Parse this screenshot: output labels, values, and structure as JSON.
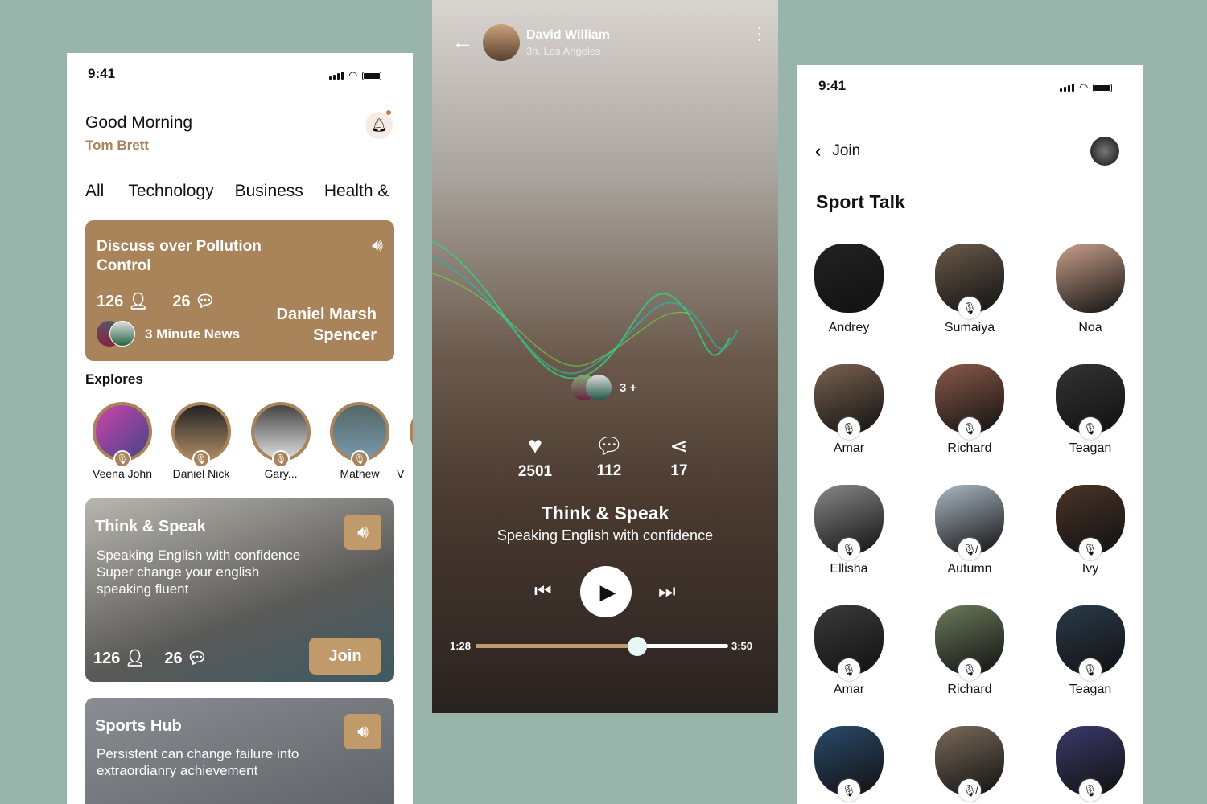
{
  "colors": {
    "background": "#98b4ab",
    "accent": "#a98359",
    "progress": "#c09a6a"
  },
  "left": {
    "time": "9:41",
    "greeting": "Good Morning",
    "user": "Tom Brett",
    "tabs": [
      "All",
      "Technology",
      "Business",
      "Health &"
    ],
    "featured": {
      "title_line1": "Discuss over Pollution",
      "title_line2": "Control",
      "listeners": "126",
      "comments": "26",
      "show": "3 Minute News",
      "host_line1": "Daniel Marsh",
      "host_line2": "Spencer"
    },
    "explores_title": "Explores",
    "explores": [
      "Veena John",
      "Daniel Nick",
      "Gary...",
      "Mathew",
      "V"
    ],
    "card1": {
      "title": "Think & Speak",
      "desc1": "Speaking English with confidence",
      "desc2": "Super change your english",
      "desc3": "speaking fluent",
      "listeners": "126",
      "comments": "26",
      "join": "Join"
    },
    "card2": {
      "title": "Sports Hub",
      "desc1": "Persistent can change failure into",
      "desc2": "extraordianry achievement"
    }
  },
  "middle": {
    "host": "David William",
    "meta": "3h. Los Angeles",
    "participants_more": "3 +",
    "likes": "2501",
    "comments": "112",
    "shares": "17",
    "title": "Think & Speak",
    "subtitle": "Speaking English with confidence",
    "elapsed": "1:28",
    "duration": "3:50",
    "progress": 0.64
  },
  "right": {
    "time": "9:41",
    "back_label": "Join",
    "room_title": "Sport Talk",
    "participants": [
      {
        "name": "Andrey",
        "mic": "none",
        "color": "#222"
      },
      {
        "name": "Sumaiya",
        "mic": "on",
        "color": "#6b5a4a"
      },
      {
        "name": "Noa",
        "mic": "none",
        "color": "#c9a08a"
      },
      {
        "name": "Amar",
        "mic": "on",
        "color": "#7a6250"
      },
      {
        "name": "Richard",
        "mic": "on",
        "color": "#8a5a4a"
      },
      {
        "name": "Teagan",
        "mic": "on",
        "color": "#333"
      },
      {
        "name": "Ellisha",
        "mic": "on",
        "color": "#888"
      },
      {
        "name": "Autumn",
        "mic": "muted",
        "color": "#aab8c4"
      },
      {
        "name": "Ivy",
        "mic": "on",
        "color": "#4a3428"
      },
      {
        "name": "Amar",
        "mic": "on",
        "color": "#3a3a3a"
      },
      {
        "name": "Richard",
        "mic": "on",
        "color": "#6a7a5a"
      },
      {
        "name": "Teagan",
        "mic": "on",
        "color": "#2a3a4a"
      },
      {
        "name": "",
        "mic": "on",
        "color": "#2a4a6a"
      },
      {
        "name": "",
        "mic": "muted",
        "color": "#7a6a5a"
      },
      {
        "name": "",
        "mic": "on",
        "color": "#3a3a6a"
      }
    ]
  }
}
